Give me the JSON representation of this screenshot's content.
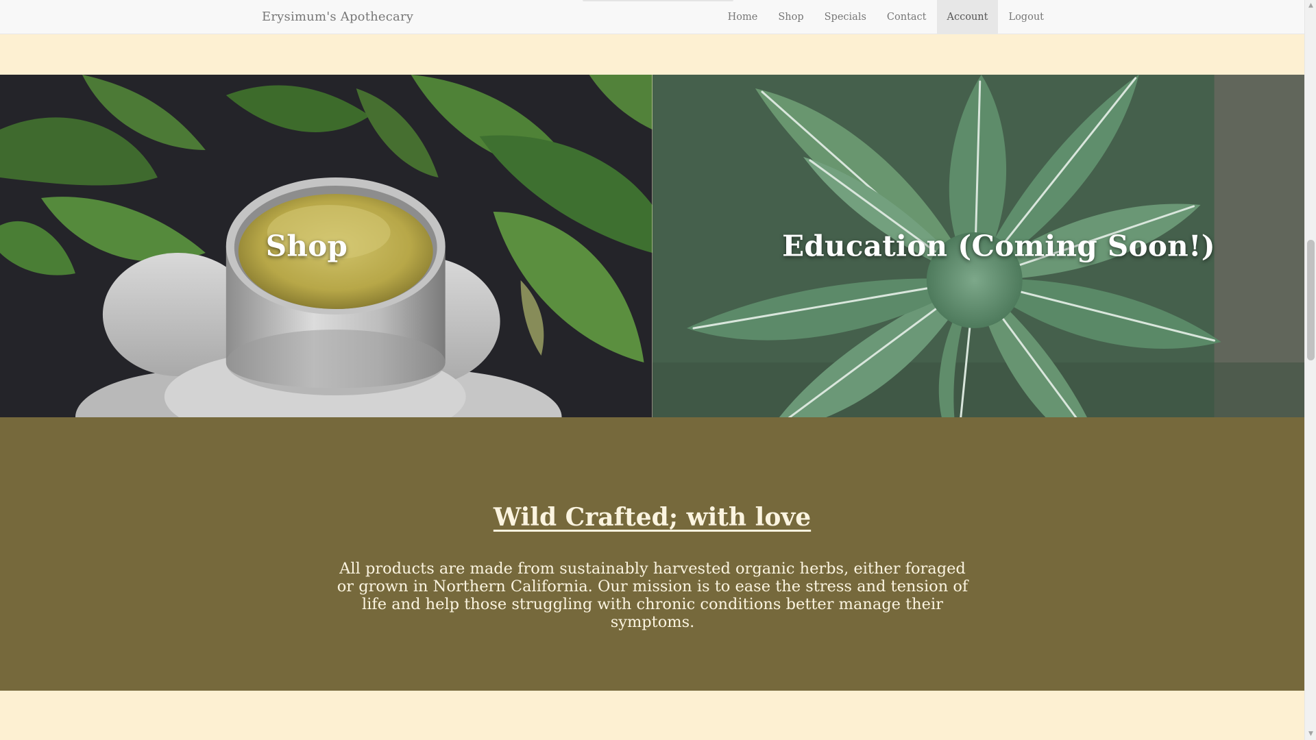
{
  "navbar": {
    "brand": "Erysimum's Apothecary",
    "links": [
      {
        "label": "Home"
      },
      {
        "label": "Shop"
      },
      {
        "label": "Specials"
      },
      {
        "label": "Contact"
      },
      {
        "label": "Account",
        "active": true
      },
      {
        "label": "Logout"
      }
    ]
  },
  "tiles": {
    "shop": {
      "label": "Shop"
    },
    "education": {
      "label": "Education (Coming Soon!)"
    }
  },
  "mission": {
    "heading": "Wild Crafted; with love",
    "body": "All products are made from sustainably harvested organic herbs, either foraged or grown in Northern California. Our mission is to ease the stress and tension of life and help those struggling with chronic conditions better manage their symptoms."
  },
  "colors": {
    "page_background": "#fdf0d2",
    "mission_background": "#76693c",
    "mission_text": "#fbf4e0",
    "navbar_background": "#f8f8f8",
    "nav_active_background": "#e7e7e7"
  },
  "scrollbar": {
    "up_icon": "triangle-up",
    "down_icon": "triangle-down"
  }
}
